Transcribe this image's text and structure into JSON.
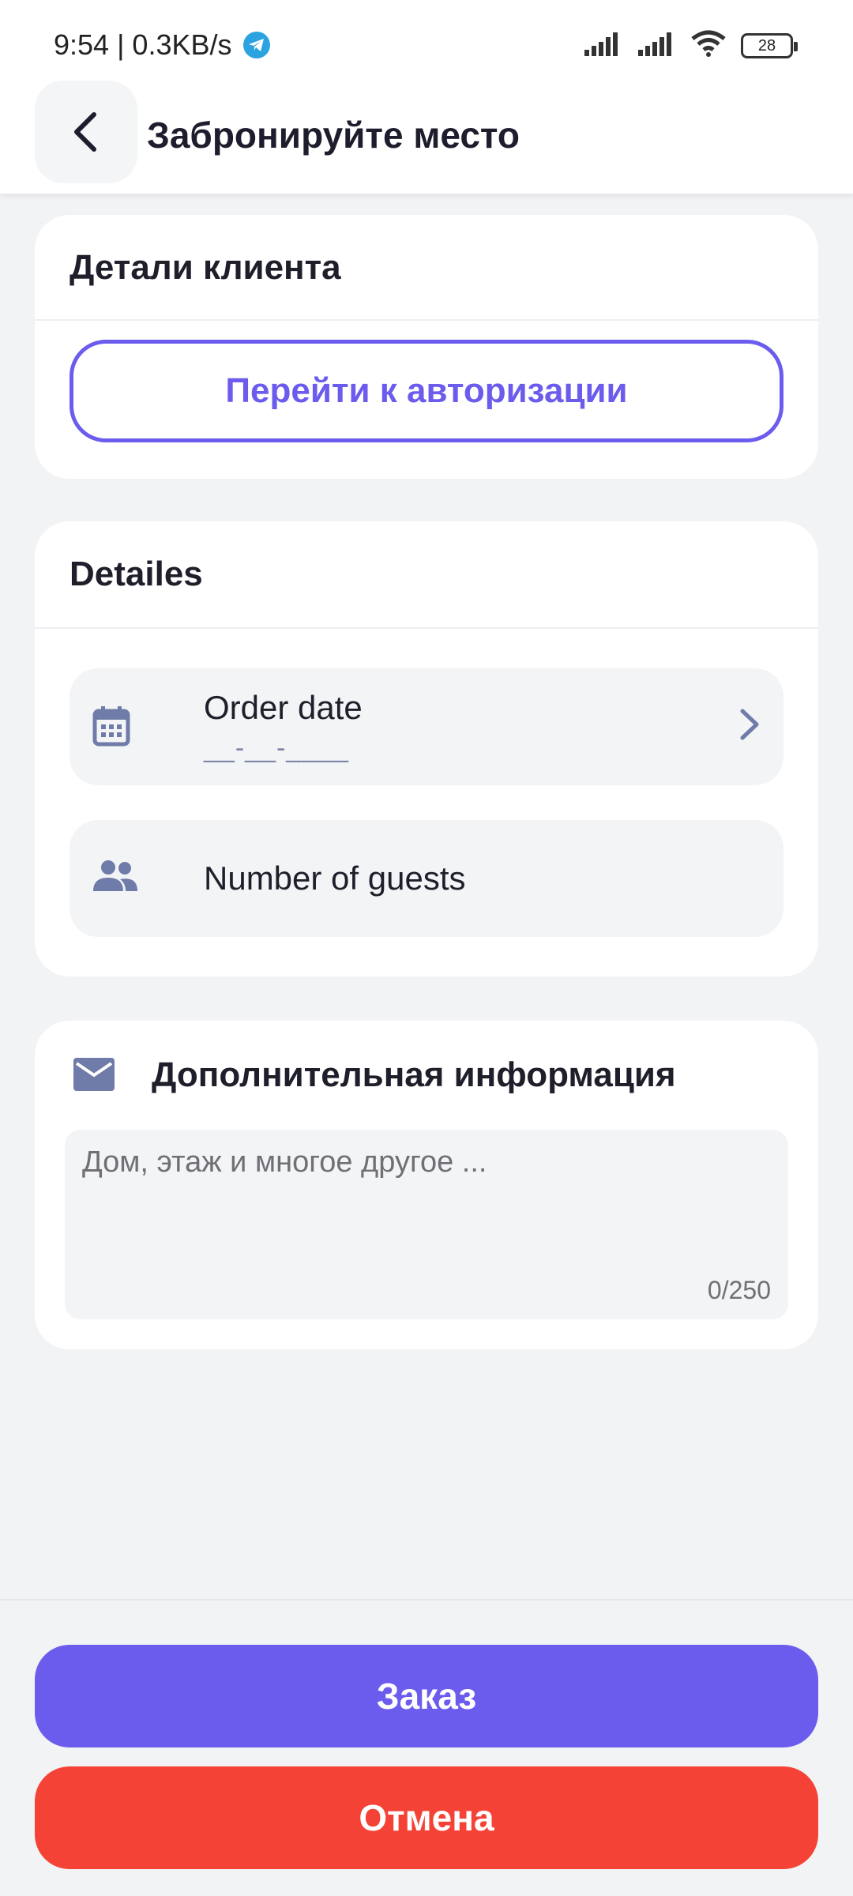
{
  "status_bar": {
    "time_speed": "9:54 | 0.3KB/s",
    "battery": "28"
  },
  "header": {
    "back_icon": "chevron-left-icon",
    "title": "Забронируйте место"
  },
  "client_card": {
    "title": "Детали клиента",
    "auth_button": "Перейти к авторизации"
  },
  "details_card": {
    "title": "Detailes",
    "order_date": {
      "icon": "calendar-icon",
      "label": "Order date",
      "value": "__-__-____"
    },
    "guests": {
      "icon": "people-icon",
      "label": "Number of guests"
    }
  },
  "extra_card": {
    "icon": "mail-icon",
    "title": "Дополнительная информация",
    "placeholder": "Дом, этаж и многое другое ...",
    "counter": "0/250"
  },
  "footer": {
    "order_button": "Заказ",
    "cancel_button": "Отмена"
  },
  "colors": {
    "accent": "#6b5ced",
    "danger": "#f44336",
    "icon": "#6f7ba8"
  }
}
